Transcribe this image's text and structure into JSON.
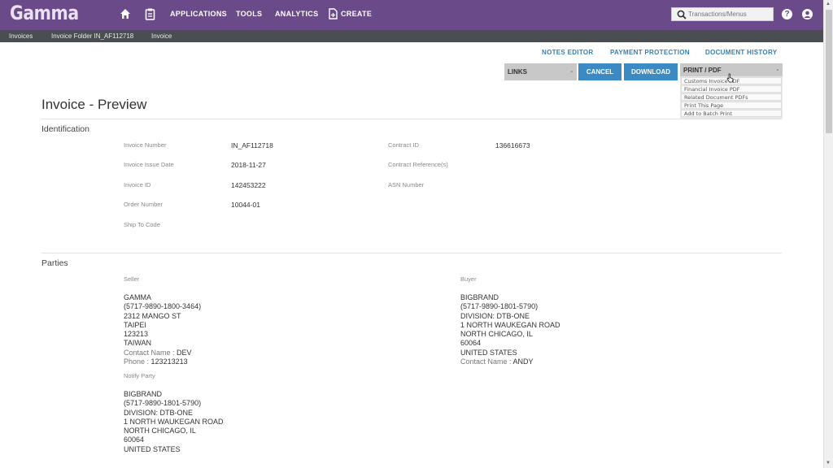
{
  "header": {
    "logo": "Gamma",
    "nav": [
      "APPLICATIONS",
      "TOOLS",
      "ANALYTICS",
      "CREATE"
    ],
    "search_placeholder": "Transactions/Menus",
    "help_glyph": "?"
  },
  "breadcrumb": [
    "Invoices",
    "Invoice Folder IN_AF112718",
    "Invoice"
  ],
  "actions": {
    "links": [
      "NOTES EDITOR",
      "PAYMENT PROTECTION",
      "DOCUMENT HISTORY"
    ],
    "links_dropdown": "LINKS",
    "cancel": "CANCEL",
    "download": "DOWNLOAD",
    "print_pdf": "PRINT / PDF",
    "caret": "-",
    "print_menu": [
      "Customs Invoice PDF",
      "Financial Invoice PDF",
      "Related Document PDFs",
      "Print This Page",
      "Add to Batch Print"
    ]
  },
  "page": {
    "title": "Invoice - Preview"
  },
  "identification": {
    "title": "Identification",
    "left": [
      {
        "label": "Invoice Number",
        "value": "IN_AF112718"
      },
      {
        "label": "Invoice Issue Date",
        "value": "2018-11-27"
      },
      {
        "label": "Invoice ID",
        "value": "142453222"
      },
      {
        "label": "Order Number",
        "value": "10044-01"
      },
      {
        "label": "Ship To Code",
        "value": ""
      }
    ],
    "right": [
      {
        "label": "Contract ID",
        "value": "136616673"
      },
      {
        "label": "Contract Reference(s)",
        "value": ""
      },
      {
        "label": "ASN Number",
        "value": ""
      }
    ]
  },
  "parties": {
    "title": "Parties",
    "seller": {
      "label": "Seller",
      "lines": [
        "GAMMA",
        "(5717-9890-1800-3464)",
        "2312 MANGO ST",
        "TAIPEI",
        "123213",
        "TAIWAN"
      ],
      "contact_label": "Contact Name :",
      "contact": "DEV",
      "phone_label": "Phone :",
      "phone": "123213213"
    },
    "buyer": {
      "label": "Buyer",
      "lines": [
        "BIGBRAND",
        "(5717-9890-1801-5790)",
        "DIVISION: DTB-ONE",
        "1 NORTH WAUKEGAN ROAD",
        "NORTH CHICAGO, IL",
        "60064",
        "UNITED STATES"
      ],
      "contact_label": "Contact Name :",
      "contact": "ANDY"
    },
    "notify": {
      "label": "Notify Party",
      "lines": [
        "BIGBRAND",
        "(5717-9890-1801-5790)",
        "DIVISION: DTB-ONE",
        "1 NORTH WAUKEGAN ROAD",
        "NORTH CHICAGO, IL",
        "60064",
        "UNITED STATES"
      ]
    }
  }
}
